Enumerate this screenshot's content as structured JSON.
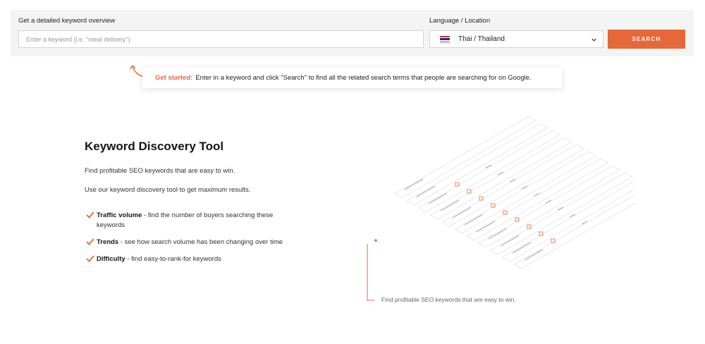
{
  "search": {
    "keyword_label": "Get a detailed keyword overview",
    "keyword_placeholder": "Enter a keyword (i.e. \"meal delivery\")",
    "language_label": "Language / Location",
    "language_value": "Thai / Thailand",
    "button_label": "SEARCH"
  },
  "tip": {
    "strong": "Get started:",
    "text": "Enter in a keyword and click \"Search\" to find all the related search terms that people are searching for on Google."
  },
  "intro": {
    "title": "Keyword Discovery Tool",
    "line1": "Find profitable SEO keywords that are easy to win.",
    "line2": "Use our keyword discovery tool to get maximum results."
  },
  "features": [
    {
      "title": "Traffic volume",
      "desc": " - find the number of buyers searching these",
      "desc2": "keywords"
    },
    {
      "title": "Trends",
      "desc": " - see how search volume has been changing over time"
    },
    {
      "title": "Difficulty",
      "desc": " - find easy-to-rank-for keywords"
    }
  ],
  "caption": "Find profitable SEO keywords that are easy to win.",
  "colors": {
    "accent": "#e6683a",
    "panel": "#f3f4f3"
  },
  "icons": {
    "check": "checkmark-icon",
    "chevron": "chevron-down-icon",
    "flag": "thailand-flag-icon"
  }
}
